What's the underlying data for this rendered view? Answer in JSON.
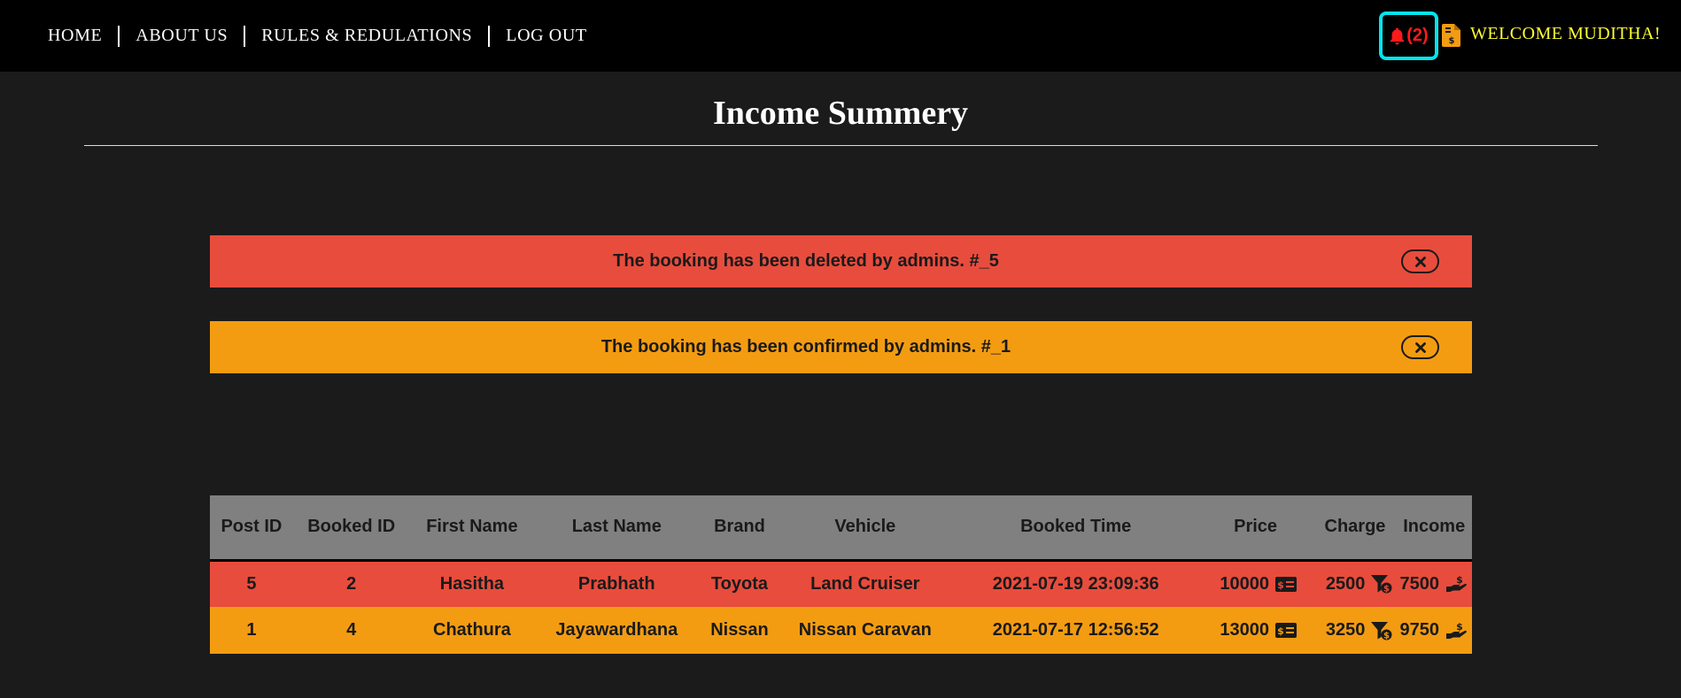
{
  "nav": {
    "links": [
      "HOME",
      "ABOUT US",
      "RULES & REDULATIONS",
      "LOG OUT"
    ]
  },
  "notifications": {
    "count_label": "(2)",
    "icon": "bell-icon"
  },
  "invoice_icon": "invoice-dollar-icon",
  "welcome": "WELCOME MUDITHA!",
  "page": {
    "title": "Income Summery"
  },
  "alerts": [
    {
      "text": "The booking has been deleted by admins. #_5",
      "color": "#e84c3d"
    },
    {
      "text": "The booking has been confirmed by admins. #_1",
      "color": "#f39c12"
    }
  ],
  "table": {
    "headers": [
      "Post ID",
      "Booked ID",
      "First Name",
      "Last Name",
      "Brand",
      "Vehicle",
      "Booked Time",
      "Price",
      "Charge",
      "Income"
    ],
    "rows": [
      {
        "post_id": "5",
        "booked_id": "2",
        "first_name": "Hasitha",
        "last_name": "Prabhath",
        "brand": "Toyota",
        "vehicle": "Land Cruiser",
        "booked_time": "2021-07-19 23:09:36",
        "price": "10000",
        "charge": "2500",
        "income": "7500"
      },
      {
        "post_id": "1",
        "booked_id": "4",
        "first_name": "Chathura",
        "last_name": "Jayawardhana",
        "brand": "Nissan",
        "vehicle": "Nissan Caravan",
        "booked_time": "2021-07-17 12:56:52",
        "price": "13000",
        "charge": "3250",
        "income": "9750"
      }
    ]
  },
  "colors": {
    "navbar": "#000000",
    "background": "#1b1b1b",
    "accent_cyan": "#00e5ee",
    "welcome_yellow": "#ffff33",
    "alert_red": "#e84c3d",
    "alert_orange": "#f39c12",
    "table_header": "#808080"
  }
}
